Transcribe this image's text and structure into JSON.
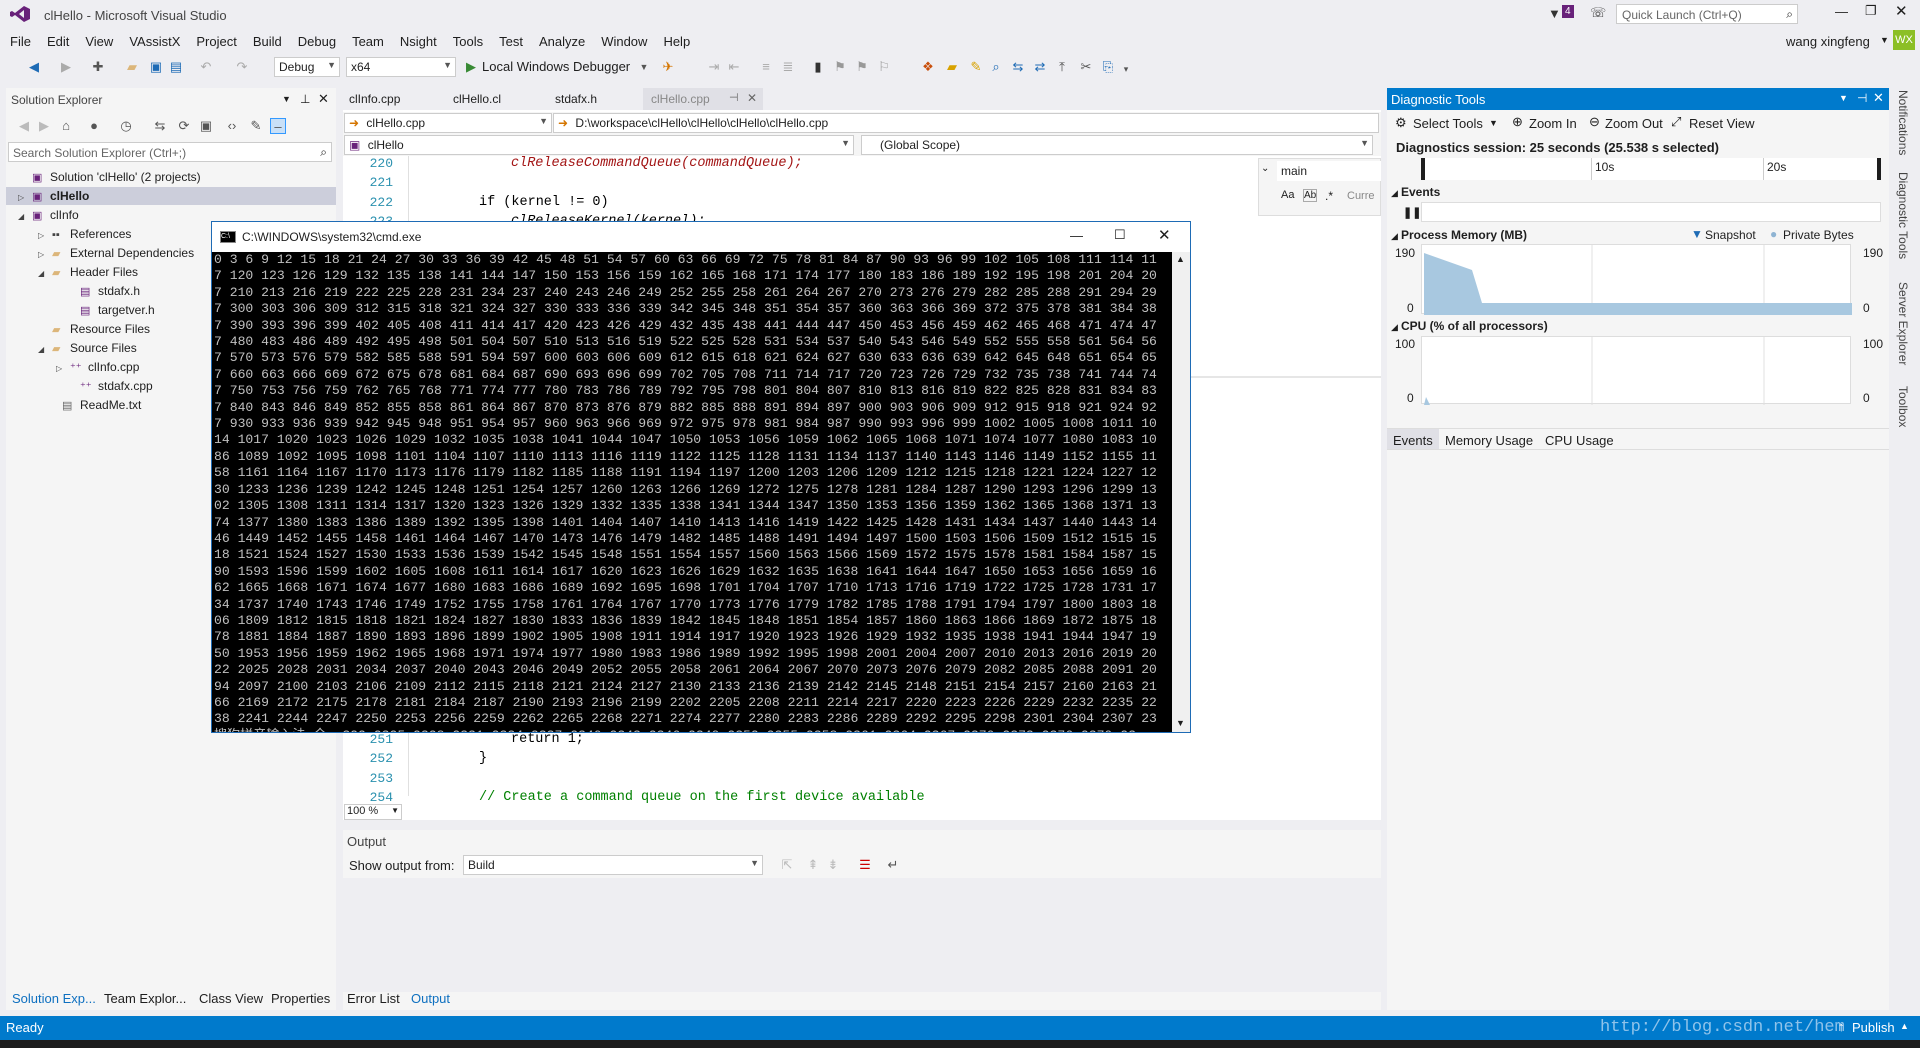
{
  "window": {
    "title": "clHello - Microsoft Visual Studio",
    "notification_count": "4",
    "quick_launch_placeholder": "Quick Launch (Ctrl+Q)",
    "user_name": "wang xingfeng",
    "user_initials": "WX"
  },
  "menu": [
    "File",
    "Edit",
    "View",
    "VAssistX",
    "Project",
    "Build",
    "Debug",
    "Team",
    "Nsight",
    "Tools",
    "Test",
    "Analyze",
    "Window",
    "Help"
  ],
  "toolbar": {
    "configuration": "Debug",
    "platform": "x64",
    "debugger": "Local Windows Debugger"
  },
  "solution_explorer": {
    "title": "Solution Explorer",
    "search_placeholder": "Search Solution Explorer (Ctrl+;)",
    "items": [
      {
        "label": "Solution 'clHello' (2 projects)"
      },
      {
        "label": "clHello"
      },
      {
        "label": "clInfo"
      },
      {
        "label": "References"
      },
      {
        "label": "External Dependencies"
      },
      {
        "label": "Header Files"
      },
      {
        "label": "stdafx.h"
      },
      {
        "label": "targetver.h"
      },
      {
        "label": "Resource Files"
      },
      {
        "label": "Source Files"
      },
      {
        "label": "clInfo.cpp"
      },
      {
        "label": "stdafx.cpp"
      },
      {
        "label": "ReadMe.txt"
      }
    ],
    "bottom_tabs": [
      "Solution Exp...",
      "Team Explor...",
      "Class View",
      "Properties"
    ]
  },
  "editor": {
    "tabs": [
      "clInfo.cpp",
      "clHello.cl",
      "stdafx.h",
      "clHello.cpp"
    ],
    "file_combo": "clHello.cpp",
    "file_path": "D:\\workspace\\clHello\\clHello\\clHello\\clHello.cpp",
    "project_combo": "clHello",
    "scope_combo": "(Global Scope)",
    "find_text": "main",
    "find_option": "Curre",
    "zoom": "100 %",
    "lines_top": [
      {
        "num": "220",
        "code": "clReleaseCommandQueue(commandQueue);"
      },
      {
        "num": "221",
        "code": ""
      },
      {
        "num": "222",
        "code": "if (kernel != 0)"
      },
      {
        "num": "223",
        "code": "clReleaseKernel(kernel);"
      }
    ],
    "lines_bottom": [
      {
        "num": "251",
        "code": "return 1;"
      },
      {
        "num": "252",
        "code": "}"
      },
      {
        "num": "253",
        "code": ""
      },
      {
        "num": "254",
        "code": "// Create a command queue on the first device available"
      }
    ]
  },
  "cmd": {
    "title": "C:\\WINDOWS\\system32\\cmd.exe",
    "ime_text": "搜狗拼音输入法 全 :322 2325 2328 2331 2334 2337 2340 2343 2346 2349 2352 2355 2358 2361 2364 2367 2370 2373 2376 2379 23",
    "lines": [
      "0 3 6 9 12 15 18 21 24 27 30 33 36 39 42 45 48 51 54 57 60 63 66 69 72 75 78 81 84 87 90 93 96 99 102 105 108 111 114 11",
      "7 120 123 126 129 132 135 138 141 144 147 150 153 156 159 162 165 168 171 174 177 180 183 186 189 192 195 198 201 204 20",
      "7 210 213 216 219 222 225 228 231 234 237 240 243 246 249 252 255 258 261 264 267 270 273 276 279 282 285 288 291 294 29",
      "7 300 303 306 309 312 315 318 321 324 327 330 333 336 339 342 345 348 351 354 357 360 363 366 369 372 375 378 381 384 38",
      "7 390 393 396 399 402 405 408 411 414 417 420 423 426 429 432 435 438 441 444 447 450 453 456 459 462 465 468 471 474 47",
      "7 480 483 486 489 492 495 498 501 504 507 510 513 516 519 522 525 528 531 534 537 540 543 546 549 552 555 558 561 564 56",
      "7 570 573 576 579 582 585 588 591 594 597 600 603 606 609 612 615 618 621 624 627 630 633 636 639 642 645 648 651 654 65",
      "7 660 663 666 669 672 675 678 681 684 687 690 693 696 699 702 705 708 711 714 717 720 723 726 729 732 735 738 741 744 74",
      "7 750 753 756 759 762 765 768 771 774 777 780 783 786 789 792 795 798 801 804 807 810 813 816 819 822 825 828 831 834 83",
      "7 840 843 846 849 852 855 858 861 864 867 870 873 876 879 882 885 888 891 894 897 900 903 906 909 912 915 918 921 924 92",
      "7 930 933 936 939 942 945 948 951 954 957 960 963 966 969 972 975 978 981 984 987 990 993 996 999 1002 1005 1008 1011 10",
      "14 1017 1020 1023 1026 1029 1032 1035 1038 1041 1044 1047 1050 1053 1056 1059 1062 1065 1068 1071 1074 1077 1080 1083 10",
      "86 1089 1092 1095 1098 1101 1104 1107 1110 1113 1116 1119 1122 1125 1128 1131 1134 1137 1140 1143 1146 1149 1152 1155 11",
      "58 1161 1164 1167 1170 1173 1176 1179 1182 1185 1188 1191 1194 1197 1200 1203 1206 1209 1212 1215 1218 1221 1224 1227 12",
      "30 1233 1236 1239 1242 1245 1248 1251 1254 1257 1260 1263 1266 1269 1272 1275 1278 1281 1284 1287 1290 1293 1296 1299 13",
      "02 1305 1308 1311 1314 1317 1320 1323 1326 1329 1332 1335 1338 1341 1344 1347 1350 1353 1356 1359 1362 1365 1368 1371 13",
      "74 1377 1380 1383 1386 1389 1392 1395 1398 1401 1404 1407 1410 1413 1416 1419 1422 1425 1428 1431 1434 1437 1440 1443 14",
      "46 1449 1452 1455 1458 1461 1464 1467 1470 1473 1476 1479 1482 1485 1488 1491 1494 1497 1500 1503 1506 1509 1512 1515 15",
      "18 1521 1524 1527 1530 1533 1536 1539 1542 1545 1548 1551 1554 1557 1560 1563 1566 1569 1572 1575 1578 1581 1584 1587 15",
      "90 1593 1596 1599 1602 1605 1608 1611 1614 1617 1620 1623 1626 1629 1632 1635 1638 1641 1644 1647 1650 1653 1656 1659 16",
      "62 1665 1668 1671 1674 1677 1680 1683 1686 1689 1692 1695 1698 1701 1704 1707 1710 1713 1716 1719 1722 1725 1728 1731 17",
      "34 1737 1740 1743 1746 1749 1752 1755 1758 1761 1764 1767 1770 1773 1776 1779 1782 1785 1788 1791 1794 1797 1800 1803 18",
      "06 1809 1812 1815 1818 1821 1824 1827 1830 1833 1836 1839 1842 1845 1848 1851 1854 1857 1860 1863 1866 1869 1872 1875 18",
      "78 1881 1884 1887 1890 1893 1896 1899 1902 1905 1908 1911 1914 1917 1920 1923 1926 1929 1932 1935 1938 1941 1944 1947 19",
      "50 1953 1956 1959 1962 1965 1968 1971 1974 1977 1980 1983 1986 1989 1992 1995 1998 2001 2004 2007 2010 2013 2016 2019 20",
      "22 2025 2028 2031 2034 2037 2040 2043 2046 2049 2052 2055 2058 2061 2064 2067 2070 2073 2076 2079 2082 2085 2088 2091 20",
      "94 2097 2100 2103 2106 2109 2112 2115 2118 2121 2124 2127 2130 2133 2136 2139 2142 2145 2148 2151 2154 2157 2160 2163 21",
      "66 2169 2172 2175 2178 2181 2184 2187 2190 2193 2196 2199 2202 2205 2208 2211 2214 2217 2220 2223 2226 2229 2232 2235 22",
      "38 2241 2244 2247 2250 2253 2256 2259 2262 2265 2268 2271 2274 2277 2280 2283 2286 2289 2292 2295 2298 2301 2304 2307 23"
    ]
  },
  "output": {
    "title": "Output",
    "show_from_label": "Show output from:",
    "show_from_value": "Build",
    "bottom_tabs": [
      "Error List",
      "Output"
    ]
  },
  "diagnostic": {
    "title": "Diagnostic Tools",
    "select_tools": "Select Tools",
    "zoom_in": "Zoom In",
    "zoom_out": "Zoom Out",
    "reset_view": "Reset View",
    "session": "Diagnostics session: 25 seconds (25.538 s selected)",
    "tick_10s": "10s",
    "tick_20s": "20s",
    "events_label": "Events",
    "memory_label": "Process Memory (MB)",
    "snapshot_label": "Snapshot",
    "private_bytes_label": "Private Bytes",
    "memory_max": "190",
    "memory_min": "0",
    "cpu_label": "CPU (% of all processors)",
    "cpu_max": "100",
    "cpu_min": "0",
    "tabs": [
      "Events",
      "Memory Usage",
      "CPU Usage"
    ],
    "colors": {
      "accent": "#007acc",
      "memory_fill": "#a8c8e0"
    }
  },
  "side_tabs": [
    "Notifications",
    "Diagnostic Tools",
    "Server Explorer",
    "Toolbox"
  ],
  "status": {
    "text": "Ready",
    "publish": "Publish",
    "watermark": "http://blog.csdn.net/hem"
  }
}
